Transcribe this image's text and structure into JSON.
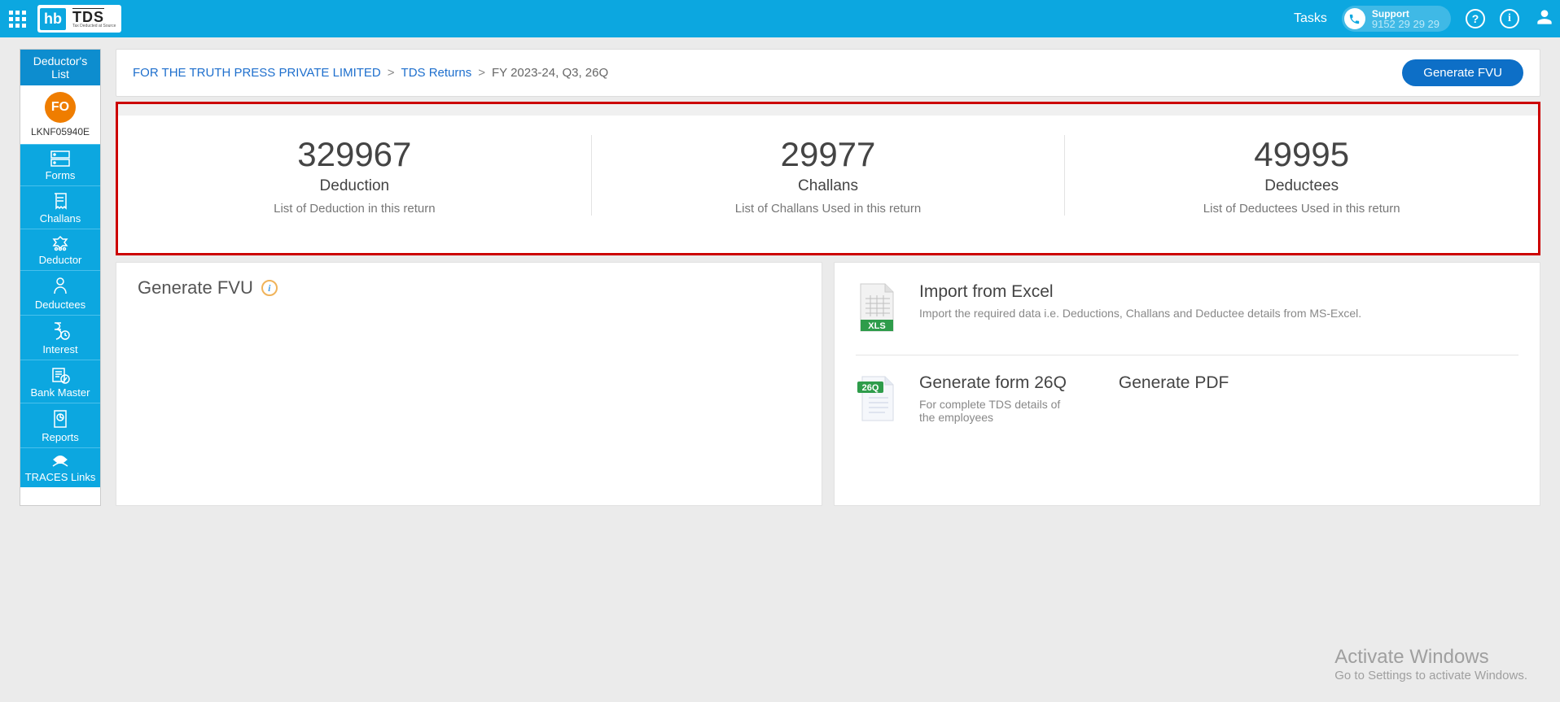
{
  "topbar": {
    "tasks": "Tasks",
    "support": "Support",
    "phone": "9152 29 29 29",
    "hb": "hb",
    "tds": "TDS",
    "tds_tag": "Tax Deducted at Source"
  },
  "sidebar": {
    "header_l1": "Deductor's",
    "header_l2": "List",
    "avatar": "FO",
    "tan": "LKNF05940E",
    "items": [
      "Forms",
      "Challans",
      "Deductor",
      "Deductees",
      "Interest",
      "Bank Master",
      "Reports",
      "TRACES Links"
    ]
  },
  "breadcrumb": {
    "company": "FOR THE TRUTH PRESS PRIVATE LIMITED",
    "section": "TDS Returns",
    "current": "FY 2023-24, Q3, 26Q",
    "button": "Generate FVU"
  },
  "stats": [
    {
      "num": "329967",
      "title": "Deduction",
      "sub": "List of Deduction in this return"
    },
    {
      "num": "29977",
      "title": "Challans",
      "sub": "List of Challans Used in this return"
    },
    {
      "num": "49995",
      "title": "Deductees",
      "sub": "List of Deductees Used in this return"
    }
  ],
  "panel_left": {
    "title": "Generate FVU"
  },
  "panel_right": {
    "import_title": "Import from Excel",
    "import_sub": "Import the required data i.e. Deductions, Challans and Deductee details from MS-Excel.",
    "xls": "XLS",
    "badge": "26Q",
    "form_title": "Generate form 26Q",
    "form_sub": "For complete TDS details of the employees",
    "pdf": "Generate PDF"
  },
  "watermark": {
    "l1": "Activate Windows",
    "l2": "Go to Settings to activate Windows."
  }
}
